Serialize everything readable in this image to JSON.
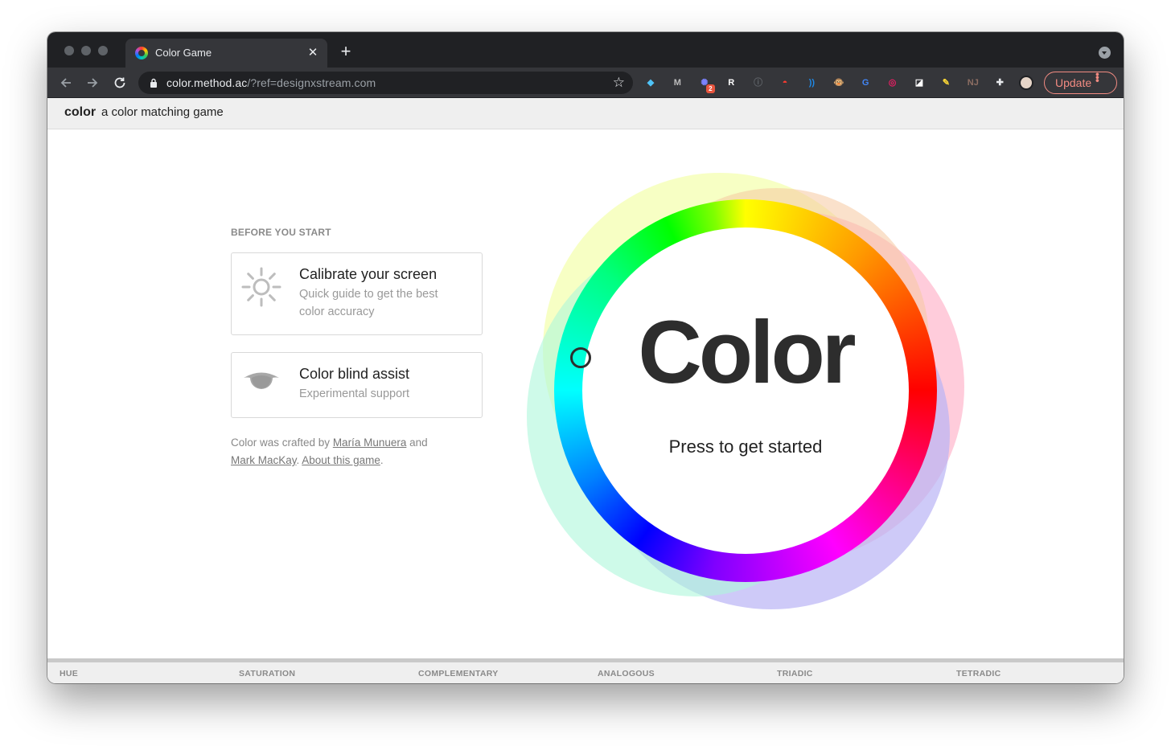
{
  "browser": {
    "tab_title": "Color Game",
    "tab_close": "✕",
    "new_tab": "+",
    "url_host": "color.method.ac",
    "url_path": "/?ref=designxstream.com",
    "update_label": "Update",
    "extensions": [
      {
        "name": "diamond-extension-icon",
        "glyph": "◆",
        "color": "#4fc3f7"
      },
      {
        "name": "m-extension-icon",
        "glyph": "M",
        "color": "#bdbdbd"
      },
      {
        "name": "sparkle-extension-icon",
        "glyph": "✺",
        "color": "#7c83fd",
        "badge": "2"
      },
      {
        "name": "r-extension-icon",
        "glyph": "R",
        "color": "#ffffff"
      },
      {
        "name": "info-extension-icon",
        "glyph": "ⓘ",
        "color": "#5f6368"
      },
      {
        "name": "pokeball-extension-icon",
        "glyph": "◓",
        "color": "#ff3b30"
      },
      {
        "name": "signal-extension-icon",
        "glyph": "))",
        "color": "#1e88e5"
      },
      {
        "name": "monkey-extension-icon",
        "glyph": "🐵",
        "color": "#c7894a"
      },
      {
        "name": "translate-extension-icon",
        "glyph": "G",
        "color": "#4285f4"
      },
      {
        "name": "color-ring-extension-icon",
        "glyph": "◎",
        "color": "#e91e63"
      },
      {
        "name": "note-extension-icon",
        "glyph": "◪",
        "color": "#ffffff"
      },
      {
        "name": "highlighter-extension-icon",
        "glyph": "✎",
        "color": "#fdd835"
      },
      {
        "name": "nj-extension-icon",
        "glyph": "NJ",
        "color": "#8d6e63"
      },
      {
        "name": "puzzle-extension-icon",
        "glyph": "✚",
        "color": "#e8eaed"
      }
    ]
  },
  "header": {
    "brand": "color",
    "tagline": "a color matching game"
  },
  "sidebar": {
    "section_label": "BEFORE YOU START",
    "cards": [
      {
        "title": "Calibrate your screen",
        "description": "Quick guide to get the best color accuracy",
        "icon": "sun-icon"
      },
      {
        "title": "Color blind assist",
        "description": "Experimental support",
        "icon": "eye-icon"
      }
    ],
    "credits": {
      "prefix": "Color was crafted by ",
      "author1": "María Munuera",
      "and": " and",
      "author2": "Mark MacKay",
      "period": ". ",
      "about": "About this game",
      "end": "."
    }
  },
  "hero": {
    "title": "Color",
    "subtitle": "Press to get started",
    "colors": {
      "blob_yellow": "#f4ffb0",
      "blob_pink": "#ffb0c8",
      "blob_violet": "#b9b3f5",
      "blob_mint": "#aef7da",
      "blob_peach": "#f5c9a0"
    }
  },
  "footer": {
    "items": [
      "HUE",
      "SATURATION",
      "COMPLEMENTARY",
      "ANALOGOUS",
      "TRIADIC",
      "TETRADIC"
    ]
  }
}
